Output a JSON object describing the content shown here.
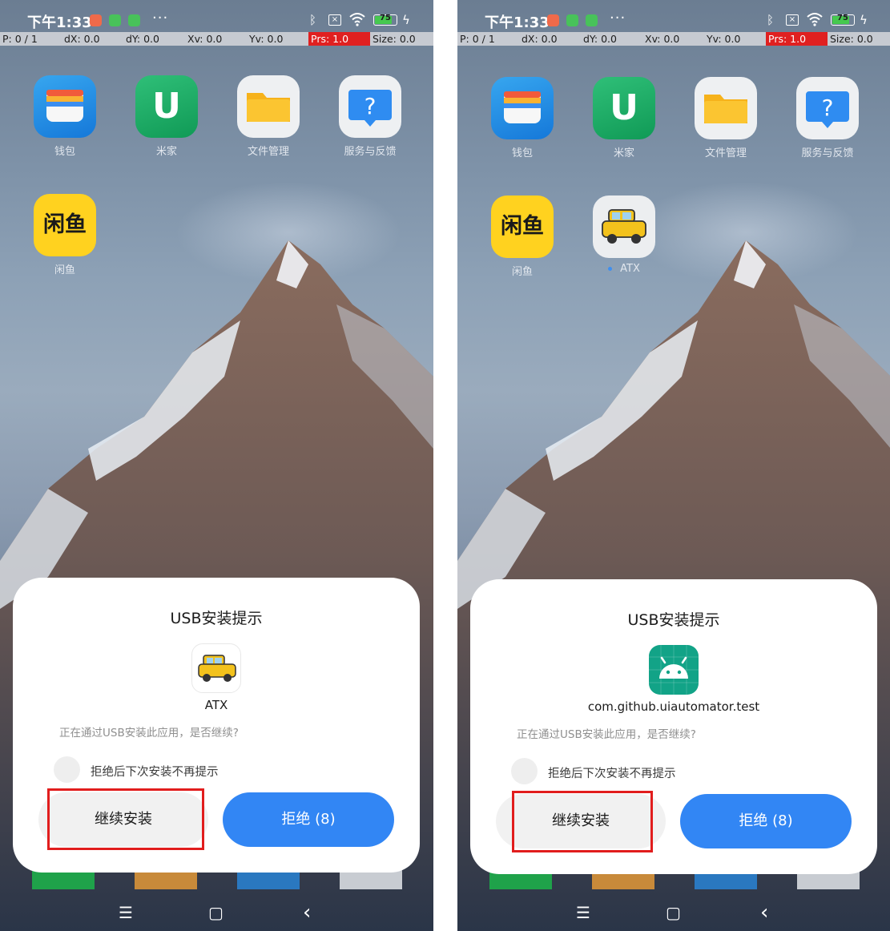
{
  "status_bar": {
    "time": "下午1:33",
    "dots": "···",
    "battery": "75",
    "bluetooth_icon": "bluetooth-icon",
    "wifi_icon": "wifi-icon"
  },
  "debug_bar": {
    "p": "P: 0 / 1",
    "dx": "dX: 0.0",
    "dy": "dY: 0.0",
    "xv": "Xv: 0.0",
    "yv": "Yv: 0.0",
    "prs": "Prs: 1.0",
    "size": "Size: 0.0"
  },
  "apps": {
    "wallet": "钱包",
    "mijia": "米家",
    "files": "文件管理",
    "service": "服务与反馈",
    "xianyu": "闲鱼",
    "atx": "ATX"
  },
  "icon_glyphs": {
    "mijia": "U",
    "service": "?",
    "xianyu": "闲鱼",
    "android": "🤖"
  },
  "left": {
    "dialog": {
      "title": "USB安装提示",
      "package_name": "ATX",
      "message": "正在通过USB安装此应用，是否继续?",
      "checkbox_label": "拒绝后下次安装不再提示",
      "continue_label": "继续安装",
      "reject_label": "拒绝 (8)"
    }
  },
  "right": {
    "dialog": {
      "title": "USB安装提示",
      "package_name": "com.github.uiautomator.test",
      "message": "正在通过USB安装此应用，是否继续?",
      "checkbox_label": "拒绝后下次安装不再提示",
      "continue_label": "继续安装",
      "reject_label": "拒绝 (8)"
    }
  },
  "nav": {
    "menu": "☰",
    "home": "▢",
    "back": "‹"
  },
  "colors": {
    "accent_blue": "#3286f4",
    "highlight_red": "#e11d1d",
    "debug_alert": "#e02020"
  }
}
